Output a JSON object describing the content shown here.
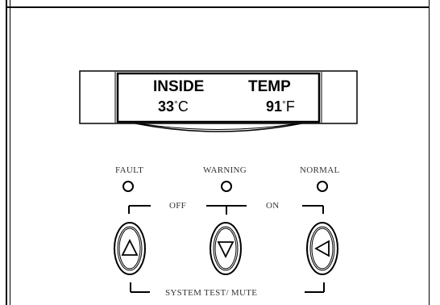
{
  "display": {
    "line1_left": "INSIDE",
    "line1_right": "TEMP",
    "temp_c": "33",
    "unit_c": "C",
    "temp_f": "91",
    "unit_f": "F",
    "degree_symbol": "°"
  },
  "indicators": {
    "fault_label": "FAULT",
    "warning_label": "WARNING",
    "normal_label": "NORMAL"
  },
  "controls": {
    "off_label": "OFF",
    "on_label": "ON",
    "system_test_label": "SYSTEM TEST/ MUTE"
  },
  "buttons": {
    "up_icon": "triangle-up-icon",
    "down_icon": "triangle-down-icon",
    "left_icon": "triangle-left-icon"
  },
  "colors": {
    "line": "#000000",
    "label_text": "#333333",
    "background": "#ffffff"
  }
}
